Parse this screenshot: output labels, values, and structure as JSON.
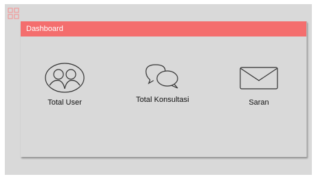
{
  "app": {
    "icon": "grid-icon"
  },
  "card": {
    "title": "Dashboard",
    "header_color": "#f46e6e"
  },
  "tiles": [
    {
      "label": "Total User",
      "icon": "users-icon"
    },
    {
      "label": "Total Konsultasi",
      "icon": "chat-bubbles-icon"
    },
    {
      "label": "Saran",
      "icon": "envelope-icon"
    }
  ]
}
